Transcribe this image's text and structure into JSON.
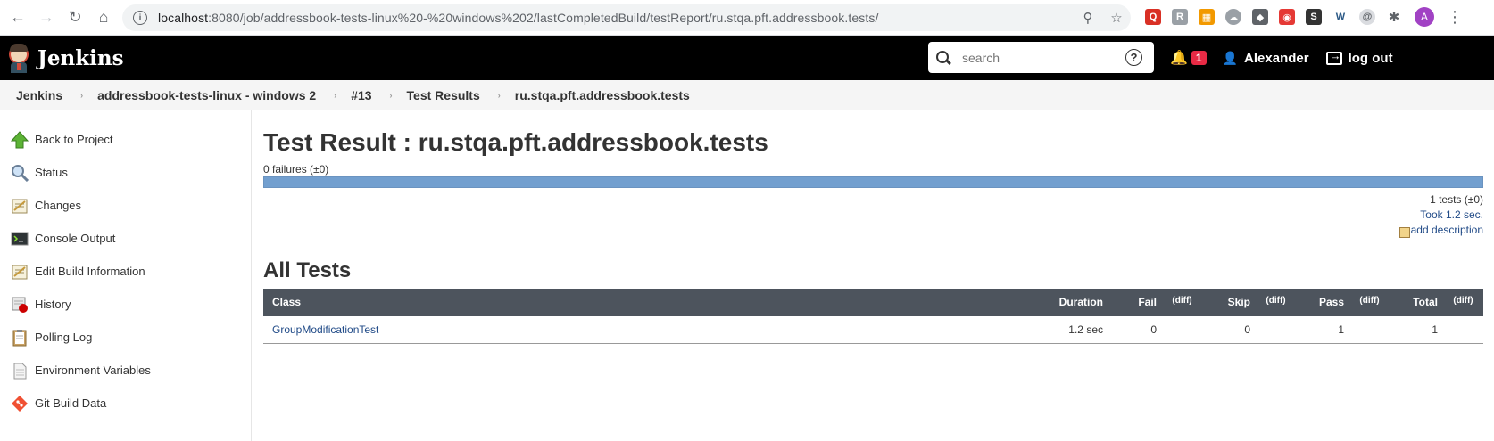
{
  "browser": {
    "url_host": "localhost",
    "url_rest": ":8080/job/addressbook-tests-linux%20-%20windows%202/lastCompletedBuild/testReport/ru.stqa.pft.addressbook.tests/",
    "avatar_letter": "A"
  },
  "header": {
    "app_name": "Jenkins",
    "search_placeholder": "search",
    "help": "?",
    "notifications": "1",
    "user": "Alexander",
    "logout": "log out"
  },
  "breadcrumbs": [
    "Jenkins",
    "addressbook-tests-linux - windows 2",
    "#13",
    "Test Results",
    "ru.stqa.pft.addressbook.tests"
  ],
  "sidebar": {
    "items": [
      {
        "label": "Back to Project",
        "icon": "up-arrow-icon"
      },
      {
        "label": "Status",
        "icon": "magnifier-icon"
      },
      {
        "label": "Changes",
        "icon": "notepad-icon"
      },
      {
        "label": "Console Output",
        "icon": "terminal-icon"
      },
      {
        "label": "Edit Build Information",
        "icon": "notepad-edit-icon"
      },
      {
        "label": "History",
        "icon": "history-icon"
      },
      {
        "label": "Polling Log",
        "icon": "clipboard-icon"
      },
      {
        "label": "Environment Variables",
        "icon": "document-icon"
      },
      {
        "label": "Git Build Data",
        "icon": "git-icon"
      }
    ]
  },
  "main": {
    "title": "Test Result : ru.stqa.pft.addressbook.tests",
    "failures": "0 failures (±0)",
    "tests_count": "1 tests (±0)",
    "took": "Took 1.2 sec.",
    "add_description": "add description",
    "all_tests_heading": "All Tests",
    "columns": [
      "Class",
      "Duration",
      "Fail",
      "(diff)",
      "Skip",
      "(diff)",
      "Pass",
      "(diff)",
      "Total",
      "(diff)"
    ],
    "rows": [
      {
        "class": "GroupModificationTest",
        "duration": "1.2 sec",
        "fail": "0",
        "fail_diff": "",
        "skip": "0",
        "skip_diff": "",
        "pass": "1",
        "pass_diff": "",
        "total": "1",
        "total_diff": ""
      }
    ]
  },
  "colors": {
    "header_bg": "#000000",
    "table_header_bg": "#4d545d",
    "progress_pass": "#729fcf",
    "link": "#204a87"
  }
}
